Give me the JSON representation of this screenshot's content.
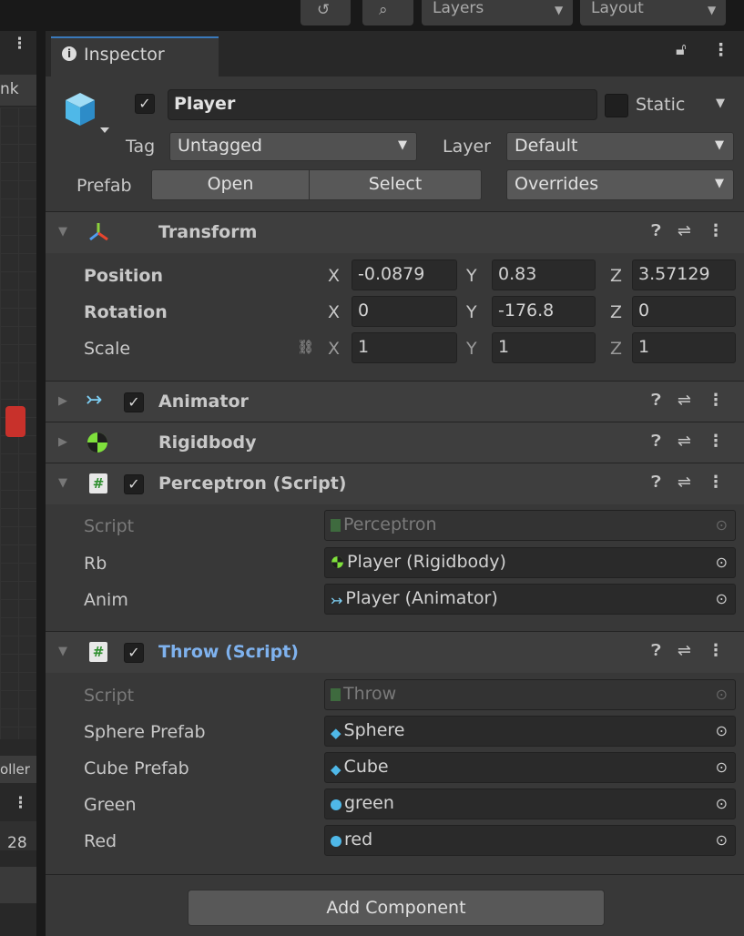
{
  "toolbar": {
    "layers_label": "Layers",
    "layout_label": "Layout"
  },
  "left_panel": {
    "text_top": "nk",
    "text_mid": "oller",
    "text_num": "28"
  },
  "inspector": {
    "tab_label": "Inspector",
    "object": {
      "enabled": true,
      "name": "Player",
      "static_label": "Static",
      "tag_label": "Tag",
      "tag_value": "Untagged",
      "layer_label": "Layer",
      "layer_value": "Default",
      "prefab_label": "Prefab",
      "prefab_open": "Open",
      "prefab_select": "Select",
      "prefab_overrides": "Overrides"
    },
    "transform": {
      "title": "Transform",
      "position_label": "Position",
      "rotation_label": "Rotation",
      "scale_label": "Scale",
      "x": "X",
      "y": "Y",
      "z": "Z",
      "position": {
        "x": "-0.0879",
        "y": "0.83",
        "z": "3.57129"
      },
      "rotation": {
        "x": "0",
        "y": "-176.8",
        "z": "0"
      },
      "scale": {
        "x": "1",
        "y": "1",
        "z": "1"
      }
    },
    "animator": {
      "title": "Animator",
      "enabled": true
    },
    "rigidbody": {
      "title": "Rigidbody"
    },
    "perceptron": {
      "title": "Perceptron (Script)",
      "script_label": "Script",
      "script_value": "Perceptron",
      "rb_label": "Rb",
      "rb_value": "Player (Rigidbody)",
      "anim_label": "Anim",
      "anim_value": "Player (Animator)"
    },
    "throw": {
      "title": "Throw (Script)",
      "script_label": "Script",
      "script_value": "Throw",
      "sphere_label": "Sphere Prefab",
      "sphere_value": "Sphere",
      "cube_label": "Cube Prefab",
      "cube_value": "Cube",
      "green_label": "Green",
      "green_value": "green",
      "red_label": "Red",
      "red_value": "red"
    },
    "add_component": "Add Component"
  },
  "colors": {
    "accent": "#3a79bb",
    "throw_title": "#7fb2ee",
    "script_icon": "#3e8e3e",
    "red_marker": "#c8312b"
  }
}
